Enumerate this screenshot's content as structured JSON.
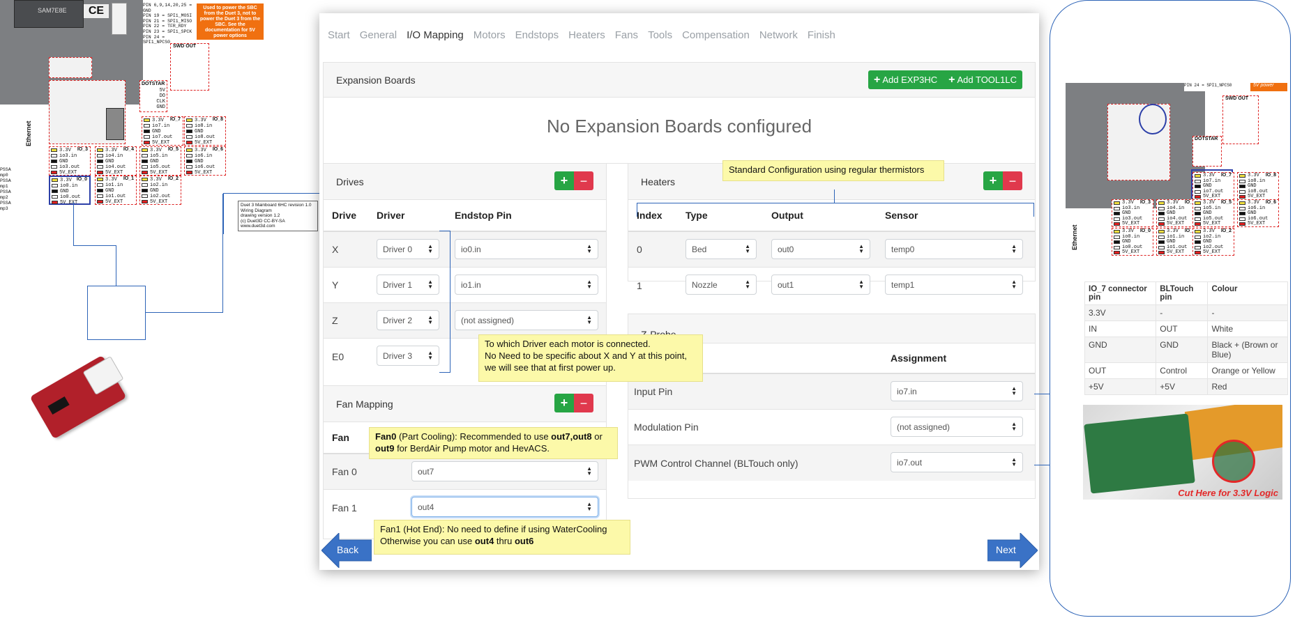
{
  "left_board": {
    "chip_label": "SAM7E8E",
    "ce_mark": "CE",
    "pin_note": [
      "PIN 6,9,14,20,25 = GND",
      "PIN 19 = SPI1_MOSI",
      "PIN 21 = SPI1_MISO",
      "PIN 22 = TFR_RDY",
      "PIN 23 = SPI1_SPCK",
      "PIN 24 = SPI1_NPCS0"
    ],
    "orange_note": "Used to power the SBC from the Duet 3, not to power the Duet 3 from the SBC. See the documentation for 5V power options",
    "swd_title": "SWD OUT",
    "swd_pins": "SWDIO SWCLK 3.3V RESET SWD_EXT_RST GND",
    "dotstar": {
      "title": "DOTSTAR",
      "lines": [
        "5V",
        "DO",
        "CLK",
        "GND"
      ]
    },
    "ethernet": "Ethernet",
    "io_blocks": [
      {
        "title": "IO_7",
        "lines": [
          "3.3V",
          "io7.in",
          "GND",
          "io7.out",
          "5V_EXT"
        ]
      },
      {
        "title": "IO_8",
        "lines": [
          "3.3V",
          "io8.in",
          "GND",
          "io8.out",
          "5V_EXT"
        ]
      },
      {
        "title": "IO_3",
        "lines": [
          "3.3V",
          "io3.in",
          "GND",
          "io3.out",
          "5V_EXT"
        ]
      },
      {
        "title": "IO_4",
        "lines": [
          "3.3V",
          "io4.in",
          "GND",
          "io4.out",
          "5V_EXT"
        ]
      },
      {
        "title": "IO_5",
        "lines": [
          "3.3V",
          "io5.in",
          "GND",
          "io5.out",
          "5V_EXT"
        ]
      },
      {
        "title": "IO_6",
        "lines": [
          "3.3V",
          "io6.in",
          "GND",
          "io6.out",
          "5V_EXT"
        ]
      },
      {
        "title": "IO_0",
        "lines": [
          "3.3V",
          "io0.in",
          "GND",
          "io0.out",
          "5V_EXT"
        ]
      },
      {
        "title": "IO_1",
        "lines": [
          "3.3V",
          "io1.in",
          "GND",
          "io1.out",
          "5V_EXT"
        ]
      },
      {
        "title": "IO_2",
        "lines": [
          "3.3V",
          "io2.in",
          "GND",
          "io2.out",
          "5V_EXT"
        ]
      }
    ],
    "edge_labels": [
      "PSSA",
      "mp0",
      "PSSA",
      "mp1",
      "PSSA",
      "mp2",
      "PSSA",
      "mp3"
    ],
    "wiring_note": [
      "Duet 3 Mainboard 6HC revision 1.0",
      "Wiring Diagram",
      "drawing version 1.2",
      "(c) Duet3D CC-BY-SA",
      "www.duet3d.com"
    ]
  },
  "tabs": [
    {
      "label": "Start",
      "active": false
    },
    {
      "label": "General",
      "active": false
    },
    {
      "label": "I/O Mapping",
      "active": true
    },
    {
      "label": "Motors",
      "active": false
    },
    {
      "label": "Endstops",
      "active": false
    },
    {
      "label": "Heaters",
      "active": false
    },
    {
      "label": "Fans",
      "active": false
    },
    {
      "label": "Tools",
      "active": false
    },
    {
      "label": "Compensation",
      "active": false
    },
    {
      "label": "Network",
      "active": false
    },
    {
      "label": "Finish",
      "active": false
    }
  ],
  "expansion": {
    "title": "Expansion Boards",
    "add_exp": "Add EXP3HC",
    "add_tool": "Add TOOL1LC",
    "empty": "No Expansion Boards configured"
  },
  "drives": {
    "title": "Drives",
    "headers": [
      "Drive",
      "Driver",
      "Endstop Pin"
    ],
    "rows": [
      {
        "drive": "X",
        "driver": "Driver 0",
        "endstop": "io0.in"
      },
      {
        "drive": "Y",
        "driver": "Driver 1",
        "endstop": "io1.in"
      },
      {
        "drive": "Z",
        "driver": "Driver 2",
        "endstop": "(not assigned)"
      },
      {
        "drive": "E0",
        "driver": "Driver 3",
        "endstop": ""
      }
    ]
  },
  "fans": {
    "title": "Fan Mapping",
    "header": "Fan",
    "rows": [
      {
        "fan": "Fan 0",
        "pin": "out7"
      },
      {
        "fan": "Fan 1",
        "pin": "out4"
      }
    ]
  },
  "heaters": {
    "title": "Heaters",
    "headers": [
      "Index",
      "Type",
      "Output",
      "Sensor"
    ],
    "rows": [
      {
        "index": "0",
        "type": "Bed",
        "output": "out0",
        "sensor": "temp0"
      },
      {
        "index": "1",
        "type": "Nozzle",
        "output": "out1",
        "sensor": "temp1"
      }
    ]
  },
  "zprobe": {
    "title": "Z-Probe",
    "assignment_header": "Assignment",
    "rows": [
      {
        "label": "Input Pin",
        "value": "io7.in"
      },
      {
        "label": "Modulation Pin",
        "value": "(not assigned)"
      },
      {
        "label": "PWM Control Channel (BLTouch only)",
        "value": "io7.out"
      }
    ]
  },
  "callouts": {
    "heaters": "Standard Configuration using regular thermistors",
    "drives": [
      "To which Driver each motor is connected.",
      "No Need to be specific about X and Y at this point,",
      "we will see that at first power up."
    ],
    "fan0_bold": "Fan0",
    "fan0_a": " (Part Cooling): Recommended to use ",
    "fan0_bold2": "out7,out8",
    "fan0_b": " or ",
    "fan0_bold3": "out9",
    "fan0_c": " for BerdAir Pump motor and HevACS.",
    "fan1_line1": "Fan1 (Hot End): No need to define if using WaterCooling",
    "fan1_a": "Otherwise you can use ",
    "fan1_bold1": "out4",
    "fan1_b": " thru ",
    "fan1_bold2": "out6"
  },
  "nav": {
    "back": "Back",
    "next": "Next"
  },
  "right": {
    "table_headers": [
      "IO_7 connector pin",
      "BLTouch pin",
      "Colour"
    ],
    "table_rows": [
      [
        "3.3V",
        "-",
        "-"
      ],
      [
        "IN",
        "OUT",
        "White"
      ],
      [
        "GND",
        "GND",
        "Black + (Brown or Blue)"
      ],
      [
        "OUT",
        "Control",
        "Orange or Yellow"
      ],
      [
        "+5V",
        "+5V",
        "Red"
      ]
    ],
    "photo_caption": "Cut Here for 3.3V Logic",
    "swd_title": "SWD OUT",
    "dotstar": "DOTSTAR",
    "ethernet": "Ethernet",
    "power_label": "5V power",
    "pin24": "PIN 24 = SPI1_NPCS0"
  }
}
